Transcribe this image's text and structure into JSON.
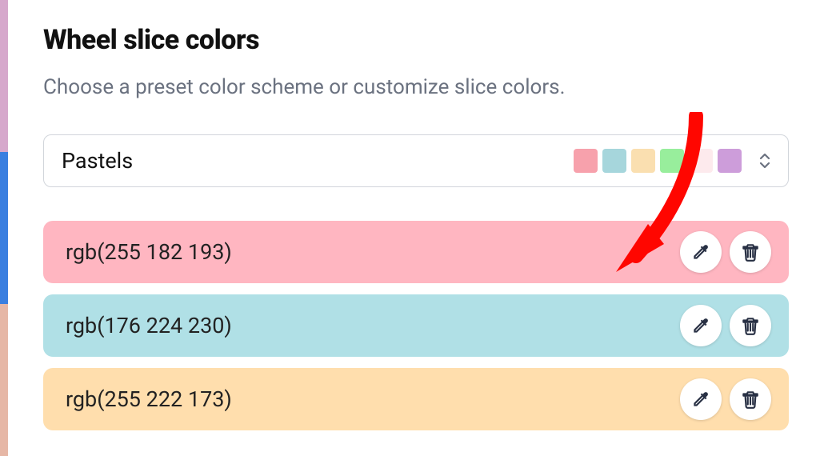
{
  "title": "Wheel slice colors",
  "subtitle": "Choose a preset color scheme or customize slice colors.",
  "preset": {
    "label": "Pastels",
    "swatches": [
      "#f7a1ac",
      "#a6d6dc",
      "#fadfb0",
      "#98ee9c",
      "#fdeaed",
      "#cd9dda"
    ]
  },
  "rows": [
    {
      "label": "rgb(255 182 193)",
      "bg": "#ffb6c1"
    },
    {
      "label": "rgb(176 224 230)",
      "bg": "#b0e0e6"
    },
    {
      "label": "rgb(255 222 173)",
      "bg": "#ffdead"
    }
  ],
  "annotation_arrow_color": "#ff0600",
  "left_slivers": [
    "#d6a8cc",
    "#3a7fe0",
    "#e6b7a6"
  ]
}
